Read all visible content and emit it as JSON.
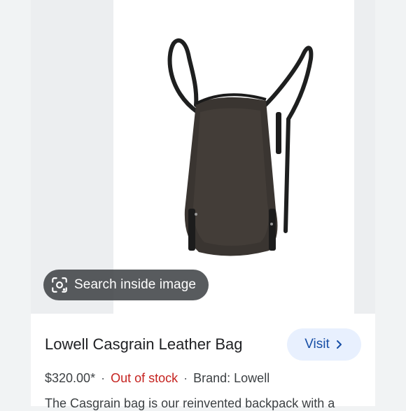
{
  "lens": {
    "label": "Search inside image",
    "icon": "lens-icon"
  },
  "product": {
    "title": "Lowell Casgrain Leather Bag",
    "visit_label": "Visit",
    "price": "$320.00*",
    "separator": "·",
    "stock": "Out of stock",
    "brand": "Brand: Lowell",
    "description": "The Casgrain bag is our reinvented backpack with a"
  },
  "colors": {
    "stock_red": "#c5221f",
    "visit_bg": "#e8f0fe",
    "visit_text": "#174ea6"
  }
}
